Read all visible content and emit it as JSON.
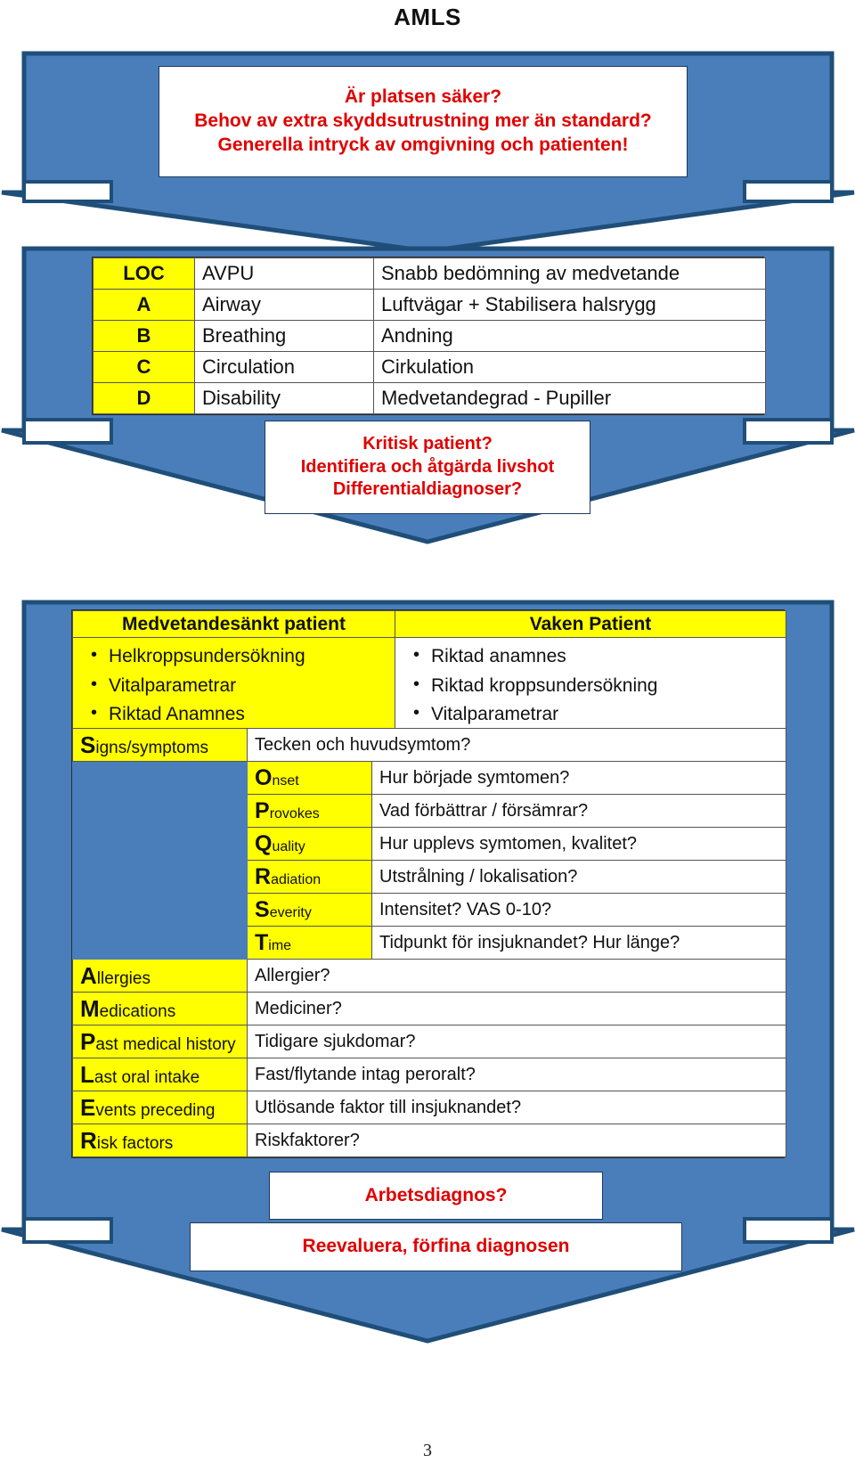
{
  "document": {
    "title": "AMLS",
    "page_number": "3"
  },
  "colors": {
    "arrow_fill": "#4a7ebb",
    "arrow_stroke": "#1f4e79",
    "highlight": "#ffff00",
    "alert_text": "#e00000"
  },
  "scene_assessment": {
    "callout_lines": [
      "Är platsen säker?",
      "Behov av extra skyddsutrustning mer än standard?",
      "Generella intryck av omgivning och patienten!"
    ]
  },
  "primary_survey": {
    "rows": [
      {
        "key": "LOC",
        "term": "AVPU",
        "desc": "Snabb bedömning av medvetande"
      },
      {
        "key": "A",
        "term": "Airway",
        "desc": "Luftvägar + Stabilisera halsrygg"
      },
      {
        "key": "B",
        "term": "Breathing",
        "desc": "Andning"
      },
      {
        "key": "C",
        "term": "Circulation",
        "desc": "Cirkulation"
      },
      {
        "key": "D",
        "term": "Disability",
        "desc": "Medvetandegrad - Pupiller"
      }
    ],
    "callout_lines": [
      "Kritisk patient?",
      "Identifiera och åtgärda livshot",
      "Differentialdiagnoser?"
    ]
  },
  "secondary_survey": {
    "columns": [
      {
        "header": "Medvetandesänkt patient",
        "items": [
          "Helkroppsundersökning",
          "Vitalparametrar",
          "Riktad Anamnes"
        ]
      },
      {
        "header": "Vaken Patient",
        "items": [
          "Riktad anamnes",
          "Riktad kroppsundersökning",
          "Vitalparametrar"
        ]
      }
    ],
    "history_rows": [
      {
        "cap": "S",
        "rest": "igns/symptoms",
        "level": "outer",
        "desc": "Tecken och huvudsymtom?"
      },
      {
        "cap": "O",
        "rest": "nset",
        "level": "inner",
        "desc": "Hur började symtomen?"
      },
      {
        "cap": "P",
        "rest": "rovokes",
        "level": "inner",
        "desc": "Vad förbättrar / försämrar?"
      },
      {
        "cap": "Q",
        "rest": "uality",
        "level": "inner",
        "desc": "Hur upplevs symtomen, kvalitet?"
      },
      {
        "cap": "R",
        "rest": "adiation",
        "level": "inner",
        "desc": "Utstrålning / lokalisation?"
      },
      {
        "cap": "S",
        "rest": "everity",
        "level": "inner",
        "desc": "Intensitet? VAS 0-10?"
      },
      {
        "cap": "T",
        "rest": "ime",
        "level": "inner",
        "desc": "Tidpunkt för insjuknandet? Hur länge?"
      },
      {
        "cap": "A",
        "rest": "llergies",
        "level": "outer",
        "desc": "Allergier?"
      },
      {
        "cap": "M",
        "rest": "edications",
        "level": "outer",
        "desc": "Mediciner?"
      },
      {
        "cap": "P",
        "rest": "ast medical history",
        "level": "outer",
        "desc": "Tidigare sjukdomar?"
      },
      {
        "cap": "L",
        "rest": "ast oral intake",
        "level": "outer",
        "desc": "Fast/flytande intag peroralt?"
      },
      {
        "cap": "E",
        "rest": "vents preceding",
        "level": "outer",
        "desc": "Utlösande faktor till insjuknandet?"
      },
      {
        "cap": "R",
        "rest": "isk factors",
        "level": "outer",
        "desc": "Riskfaktorer?"
      }
    ]
  },
  "diagnosis": {
    "working_diagnosis": "Arbetsdiagnos?",
    "reevaluate": "Reevaluera, förfina diagnosen"
  }
}
